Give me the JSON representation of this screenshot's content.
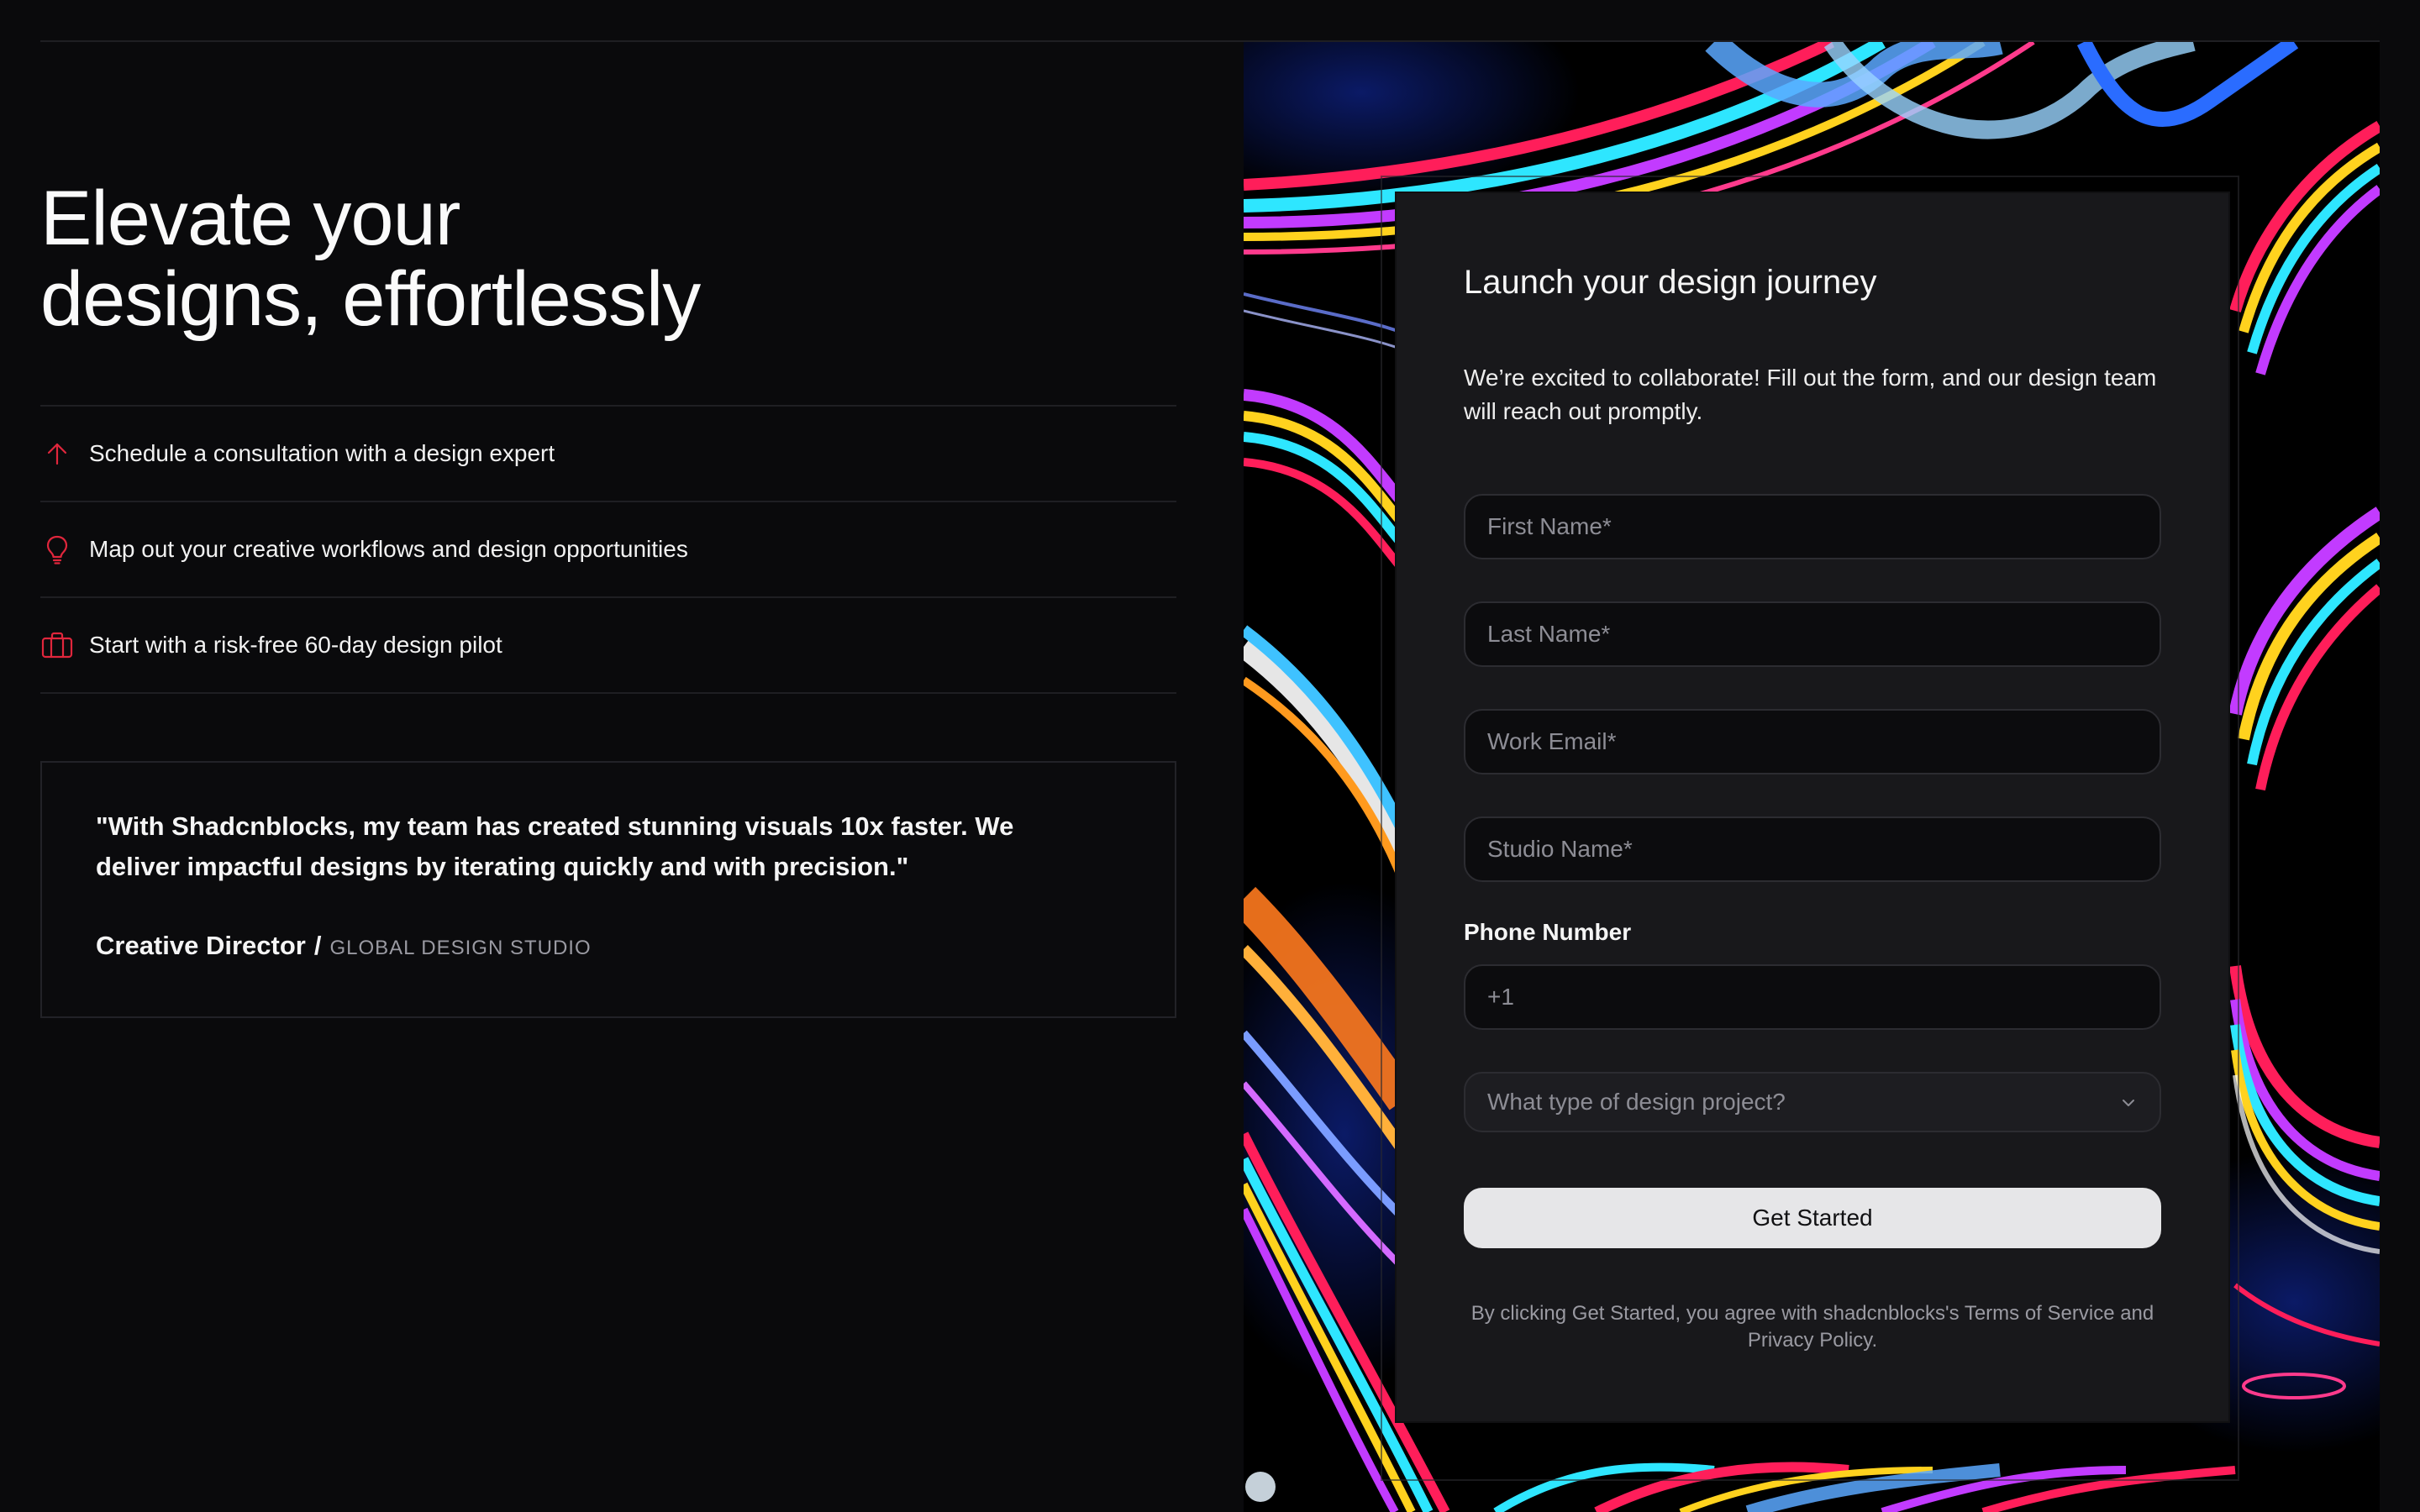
{
  "hero": {
    "line1": "Elevate your",
    "line2": "designs, effortlessly"
  },
  "features": [
    {
      "icon": "arrow-up-icon",
      "label": "Schedule a consultation with a design expert"
    },
    {
      "icon": "lightbulb-icon",
      "label": "Map out your creative workflows and design opportunities"
    },
    {
      "icon": "briefcase-icon",
      "label": "Start with a risk-free 60-day design pilot"
    }
  ],
  "testimonial": {
    "quote": "\"With Shadcnblocks, my team has created stunning visuals 10x faster. We deliver impactful designs by iterating quickly and with precision.\"",
    "role": "Creative Director",
    "separator": "/",
    "company": "GLOBAL DESIGN STUDIO"
  },
  "form": {
    "title": "Launch your design journey",
    "description": "We’re excited to collaborate! Fill out the form, and our design team will reach out promptly.",
    "first_name_placeholder": "First Name*",
    "last_name_placeholder": "Last Name*",
    "email_placeholder": "Work Email*",
    "studio_placeholder": "Studio Name*",
    "phone_label": "Phone Number",
    "phone_value": "+1",
    "project_placeholder": "What type of design project?",
    "submit_label": "Get Started",
    "legal": "By clicking Get Started, you agree with shadcnblocks's Terms of Service and Privacy Policy."
  },
  "colors": {
    "background": "#0a0a0c",
    "card": "#18181b",
    "accent_icon": "#e0263c",
    "button": "#e6e6e8"
  }
}
